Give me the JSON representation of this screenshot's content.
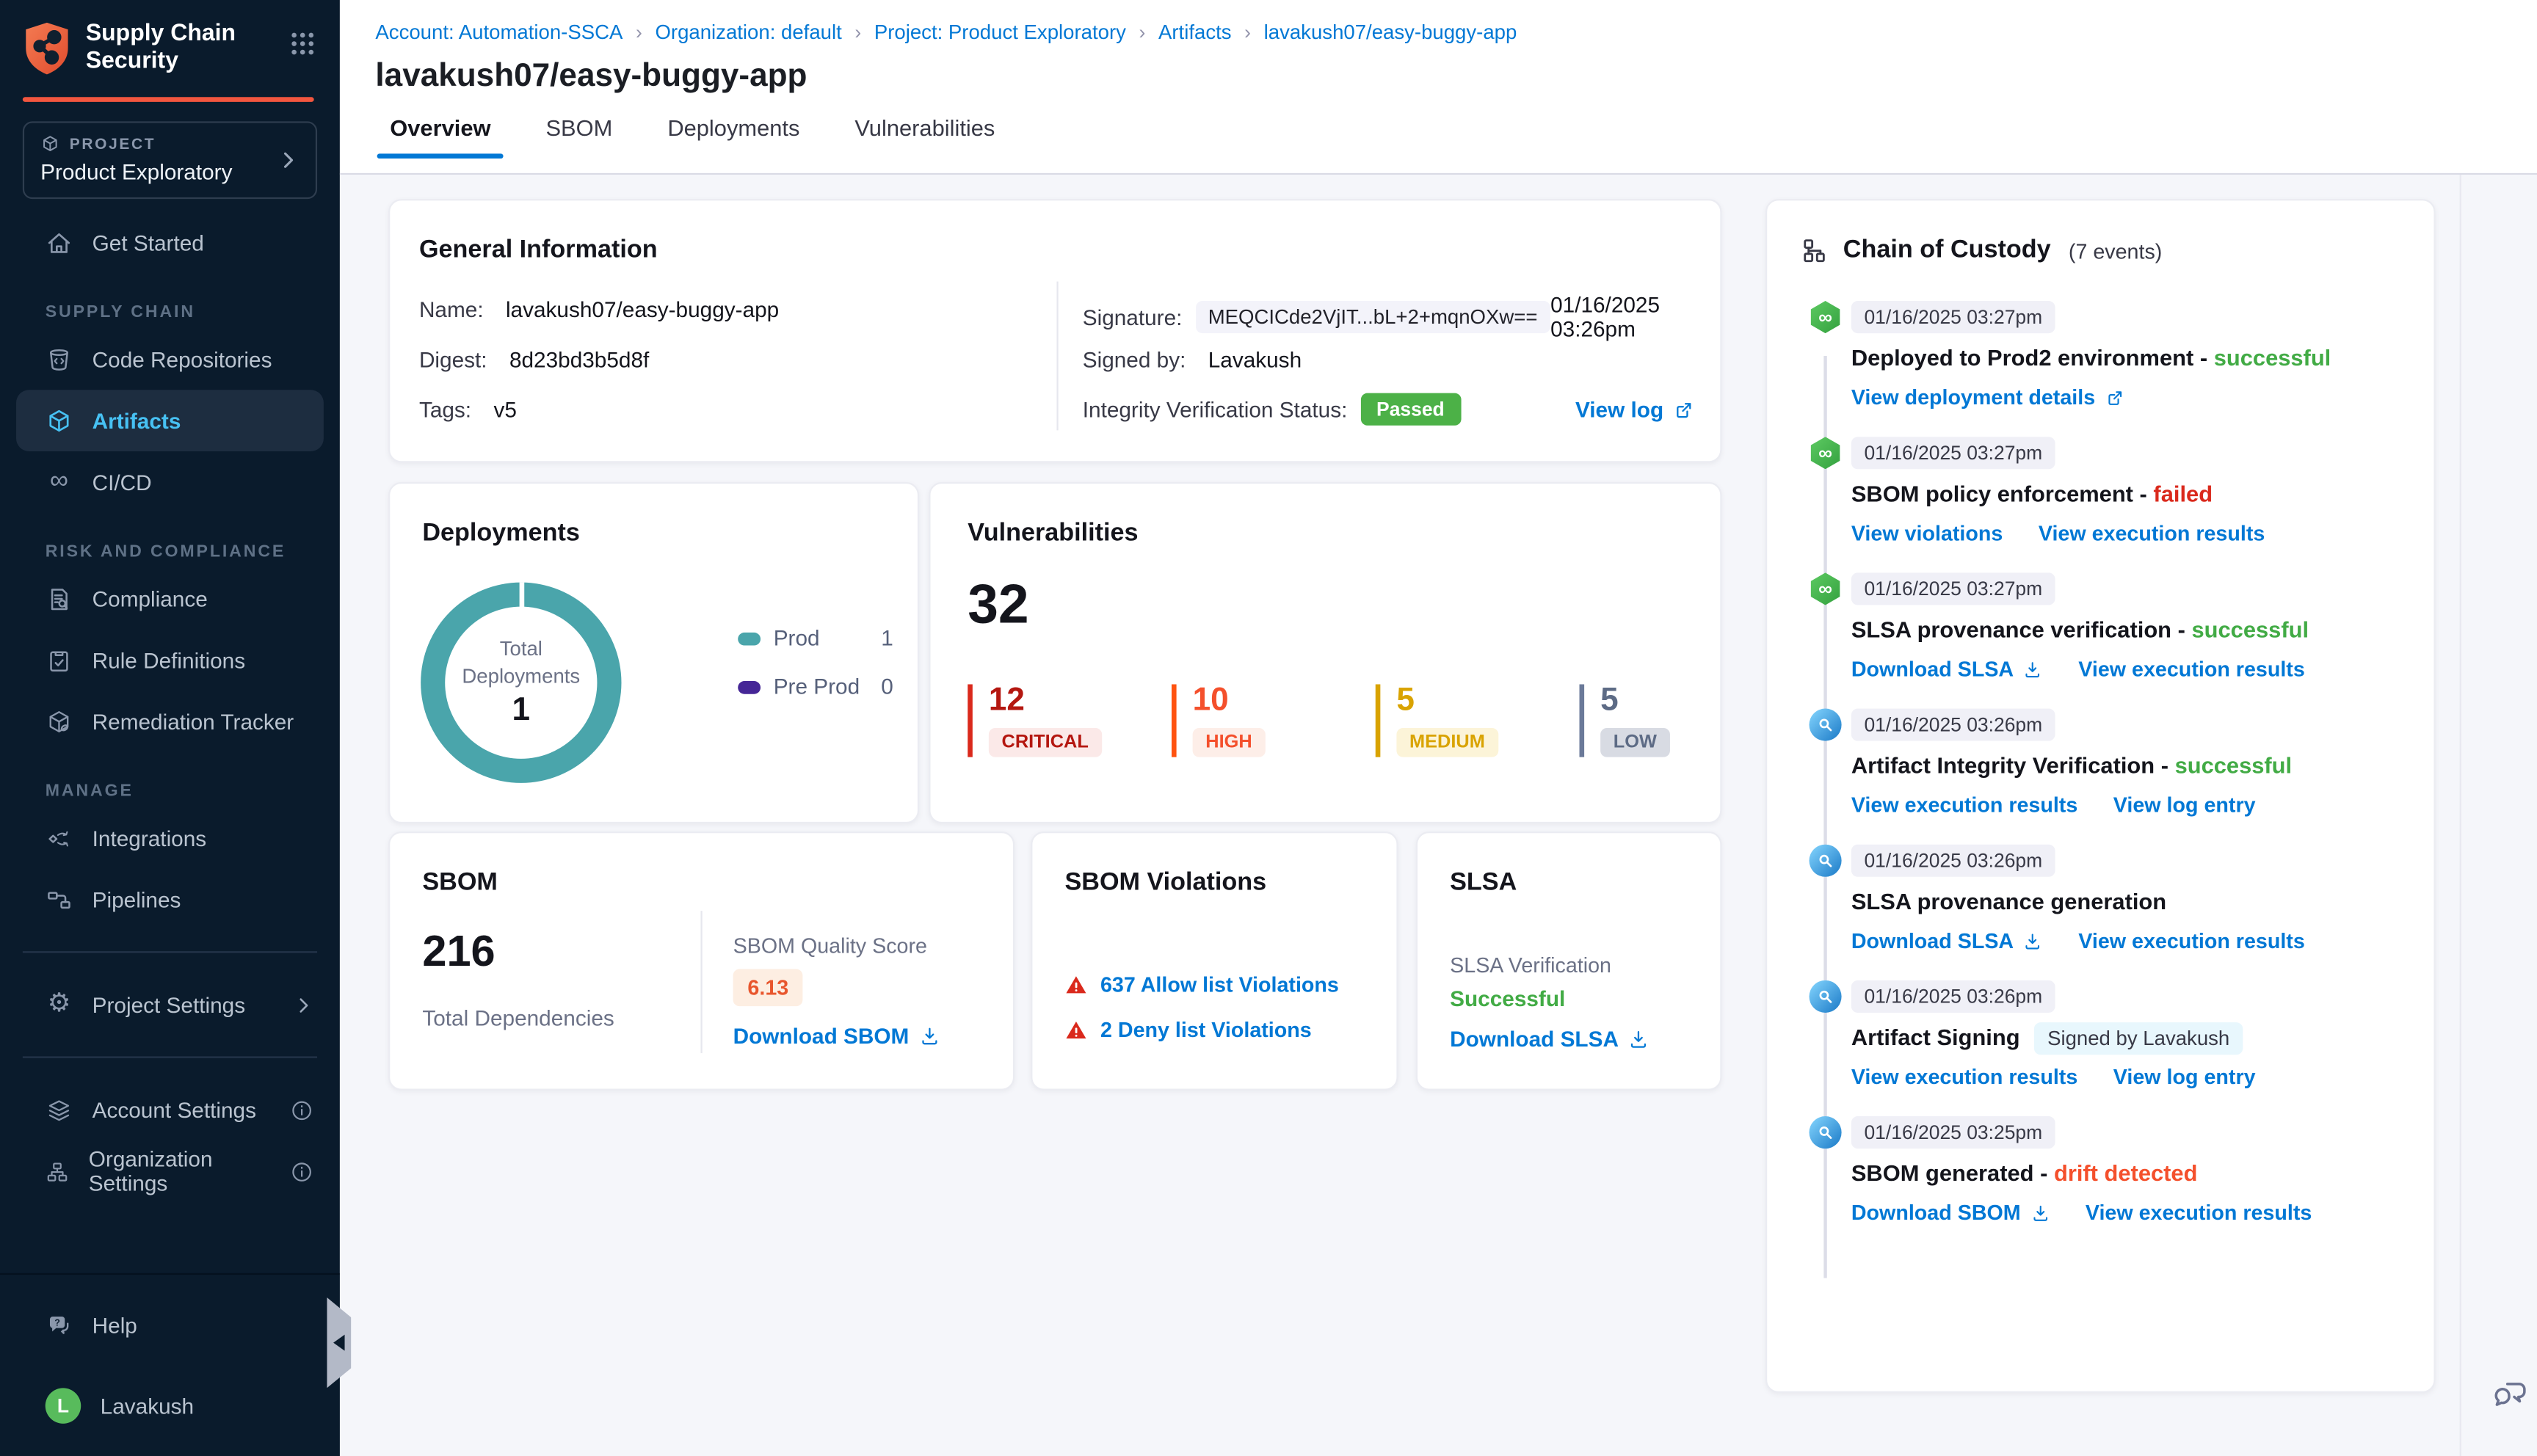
{
  "app": {
    "name": "Supply Chain Security"
  },
  "colors": {
    "brand_blue": "#0278d5",
    "accent_orange": "#f2563f",
    "success_green": "#42ab45",
    "fail_red": "#da291c",
    "drift_orange": "#f4502c",
    "donut_teal": "#4aa5ab",
    "preprod_purple": "#452696"
  },
  "sidebar": {
    "project": {
      "label": "PROJECT",
      "name": "Product Exploratory"
    },
    "get_started": "Get Started",
    "sections": {
      "supply_chain": {
        "title": "SUPPLY CHAIN",
        "items": [
          "Code Repositories",
          "Artifacts",
          "CI/CD"
        ]
      },
      "risk": {
        "title": "RISK AND COMPLIANCE",
        "items": [
          "Compliance",
          "Rule Definitions",
          "Remediation Tracker"
        ]
      },
      "manage": {
        "title": "MANAGE",
        "items": [
          "Integrations",
          "Pipelines"
        ]
      }
    },
    "project_settings": "Project Settings",
    "account_settings": "Account Settings",
    "organization_settings": "Organization Settings",
    "help": "Help",
    "user": {
      "name": "Lavakush",
      "initial": "L"
    }
  },
  "header": {
    "breadcrumb": [
      "Account: Automation-SSCA",
      "Organization: default",
      "Project: Product Exploratory",
      "Artifacts",
      "lavakush07/easy-buggy-app"
    ],
    "title": "lavakush07/easy-buggy-app",
    "tabs": [
      "Overview",
      "SBOM",
      "Deployments",
      "Vulnerabilities"
    ],
    "active_tab": "Overview"
  },
  "general_info": {
    "title": "General Information",
    "name_label": "Name:",
    "name": "lavakush07/easy-buggy-app",
    "digest_label": "Digest:",
    "digest": "8d23bd3b5d8f",
    "tags_label": "Tags:",
    "tags": "v5",
    "signature_label": "Signature:",
    "signature": "MEQCICde2VjIT...bL+2+mqnOXw==",
    "signature_time": "01/16/2025 03:26pm",
    "signed_by_label": "Signed by:",
    "signed_by": "Lavakush",
    "integrity_label": "Integrity Verification Status:",
    "integrity_status": "Passed",
    "view_log": "View log"
  },
  "deployments": {
    "title": "Deployments",
    "donut_center_label": "Total Deployments",
    "donut_center_value": "1",
    "legend": [
      {
        "label": "Prod",
        "value": "1",
        "color": "#4aa5ab"
      },
      {
        "label": "Pre Prod",
        "value": "0",
        "color": "#452696"
      }
    ]
  },
  "vulnerabilities": {
    "title": "Vulnerabilities",
    "total": "32",
    "severities": [
      {
        "label": "CRITICAL",
        "value": "12",
        "num_color": "#b41710",
        "bar_color": "#da291c",
        "badge_bg": "#fbe9e8",
        "badge_color": "#b41710"
      },
      {
        "label": "HIGH",
        "value": "10",
        "num_color": "#f4502c",
        "bar_color": "#ff5310",
        "badge_bg": "#fdeee8",
        "badge_color": "#f4502c"
      },
      {
        "label": "MEDIUM",
        "value": "5",
        "num_color": "#d9a300",
        "bar_color": "#d9a300",
        "badge_bg": "#fcf4d8",
        "badge_color": "#d9a300"
      },
      {
        "label": "LOW",
        "value": "5",
        "num_color": "#5d6b85",
        "bar_color": "#6b7a99",
        "badge_bg": "#d8dbe3",
        "badge_color": "#5d6b85"
      }
    ]
  },
  "sbom": {
    "title": "SBOM",
    "total": "216",
    "total_label": "Total Dependencies",
    "quality_label": "SBOM Quality Score",
    "quality_score": "6.13",
    "download": "Download SBOM"
  },
  "sbom_violations": {
    "title": "SBOM Violations",
    "items": [
      {
        "text": "637 Allow list Violations"
      },
      {
        "text": "2 Deny list Violations"
      }
    ]
  },
  "slsa": {
    "title": "SLSA",
    "verification_label": "SLSA Verification",
    "verification_status": "Successful",
    "download": "Download SLSA"
  },
  "chain_of_custody": {
    "title": "Chain of Custody",
    "events_count": "(7 events)",
    "events": [
      {
        "time": "01/16/2025 03:27pm",
        "title": "Deployed to Prod2 environment",
        "status": "successful",
        "status_color": "green",
        "icon": "pipeline",
        "links": [
          {
            "text": "View deployment details",
            "icon": "external"
          }
        ]
      },
      {
        "time": "01/16/2025 03:27pm",
        "title": "SBOM policy enforcement",
        "status": "failed",
        "status_color": "red",
        "icon": "pipeline",
        "links": [
          {
            "text": "View violations"
          },
          {
            "text": "View execution results"
          }
        ]
      },
      {
        "time": "01/16/2025 03:27pm",
        "title": "SLSA provenance verification",
        "status": "successful",
        "status_color": "green",
        "icon": "pipeline",
        "links": [
          {
            "text": "Download SLSA",
            "icon": "download"
          },
          {
            "text": "View execution results"
          }
        ]
      },
      {
        "time": "01/16/2025 03:26pm",
        "title": "Artifact Integrity Verification",
        "status": "successful",
        "status_color": "green",
        "icon": "scan",
        "links": [
          {
            "text": "View execution results"
          },
          {
            "text": "View log entry"
          }
        ]
      },
      {
        "time": "01/16/2025 03:26pm",
        "title": "SLSA provenance generation",
        "icon": "scan",
        "links": [
          {
            "text": "Download SLSA",
            "icon": "download"
          },
          {
            "text": "View execution results"
          }
        ]
      },
      {
        "time": "01/16/2025 03:26pm",
        "title": "Artifact Signing",
        "badge": "Signed by Lavakush",
        "icon": "scan",
        "links": [
          {
            "text": "View execution results"
          },
          {
            "text": "View log entry"
          }
        ]
      },
      {
        "time": "01/16/2025 03:25pm",
        "title": "SBOM generated",
        "status": "drift detected",
        "status_color": "orange",
        "icon": "scan",
        "links": [
          {
            "text": "Download SBOM",
            "icon": "download"
          },
          {
            "text": "View execution results"
          }
        ]
      }
    ]
  }
}
